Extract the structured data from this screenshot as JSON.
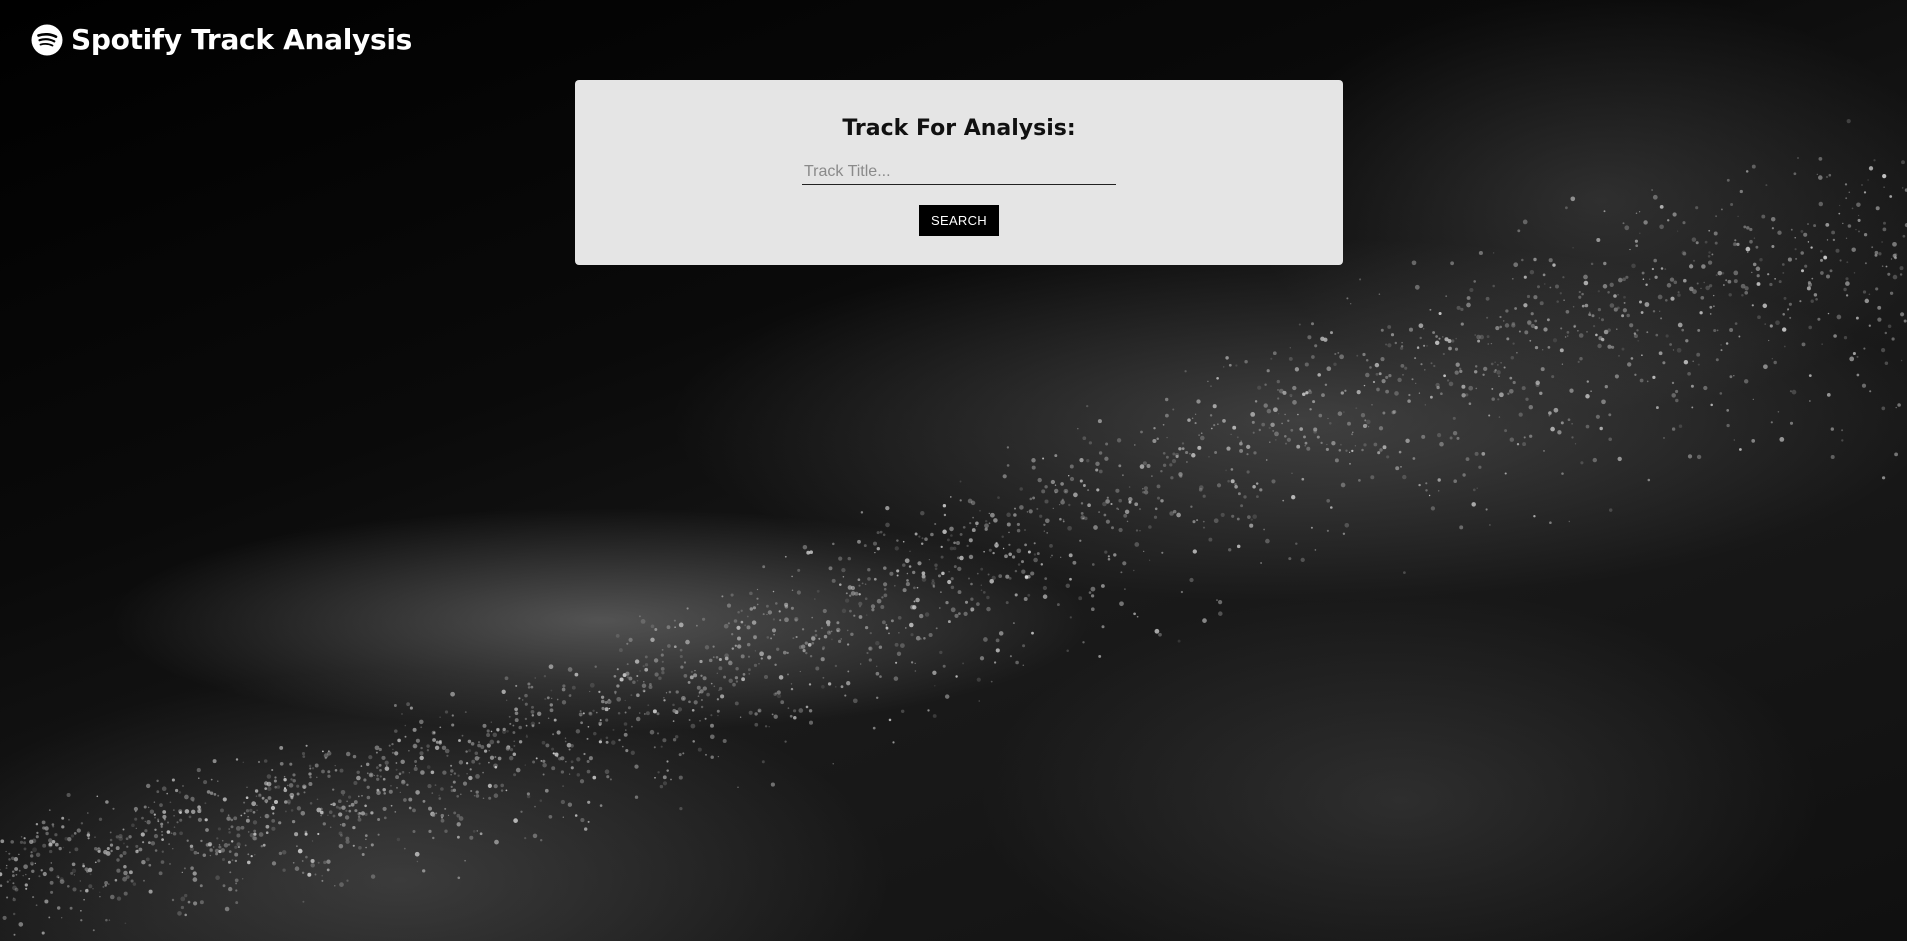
{
  "header": {
    "logo_icon": "spotify-logo-icon",
    "title": "Spotify Track Analysis"
  },
  "search_card": {
    "heading": "Track For Analysis:",
    "input": {
      "value": "",
      "placeholder": "Track Title..."
    },
    "button_label": "SEARCH"
  },
  "colors": {
    "background": "#050505",
    "card": "#ececec",
    "button": "#000000",
    "title_text": "#ffffff"
  }
}
